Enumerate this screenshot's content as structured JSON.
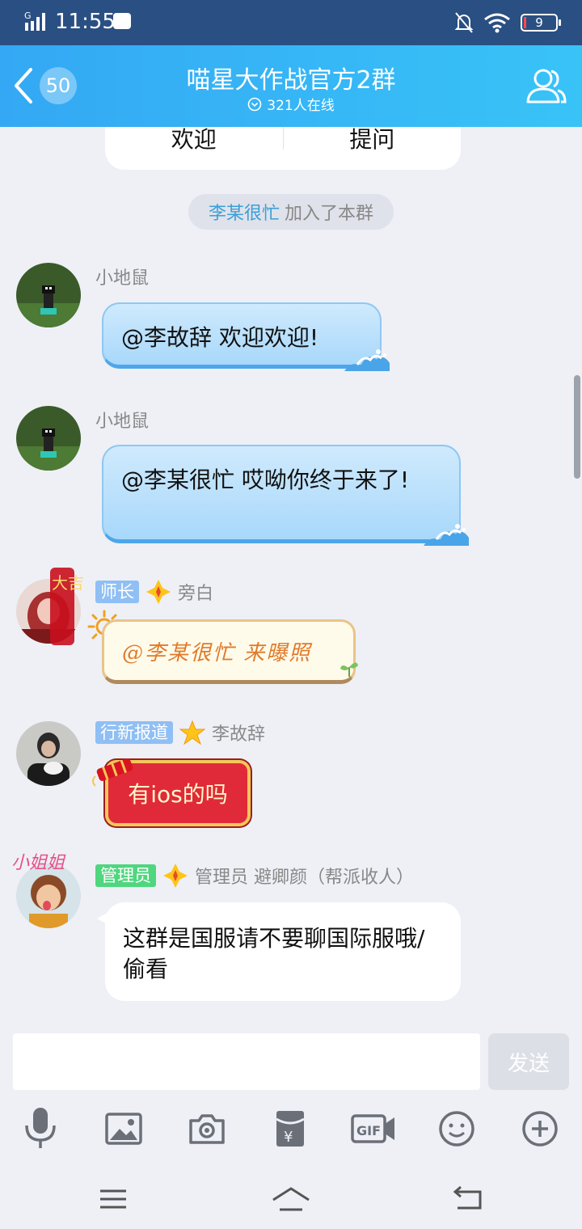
{
  "status_bar": {
    "network": "G",
    "time": "11:55",
    "battery": "9",
    "battery_level": 0.09
  },
  "header": {
    "unread_badge": "50",
    "title": "喵星大作战官方2群",
    "online": "321人在线"
  },
  "top_card": {
    "left_label": "欢迎",
    "right_label": "提问"
  },
  "system_message": {
    "name": "李某很忙",
    "text": "加入了本群"
  },
  "messages": [
    {
      "sender": "小地鼠",
      "text": "@李故辞  欢迎欢迎!"
    },
    {
      "sender": "小地鼠",
      "text": "@李某很忙  哎呦你终于来了!"
    },
    {
      "tag": "师长",
      "sender": "旁白",
      "text": "@李某很忙  来曝照"
    },
    {
      "tag": "行新报道",
      "sender": "李故辞",
      "text": "有ios的吗"
    },
    {
      "tag": "管理员",
      "sender": "管理员 避卿颜（帮派收人）",
      "text": "这群是国服请不要聊国际服哦/偷看"
    }
  ],
  "avatar_badges": {
    "leader_banner": "大吉大利",
    "sticker": "小姐姐"
  },
  "input": {
    "placeholder": "",
    "send_label": "发送"
  },
  "toolbar_icons": [
    "microphone-icon",
    "image-icon",
    "camera-icon",
    "red-packet-icon",
    "gif-icon",
    "emoji-icon",
    "plus-icon"
  ],
  "colors": {
    "header_gradient_start": "#34a8f4",
    "header_gradient_end": "#38c3f7",
    "status_bar": "#2a4f82",
    "background": "#eef0f6",
    "member_name": "#3b9fd8",
    "tag_blue": "#8fbff4",
    "tag_green": "#4fd67e"
  }
}
